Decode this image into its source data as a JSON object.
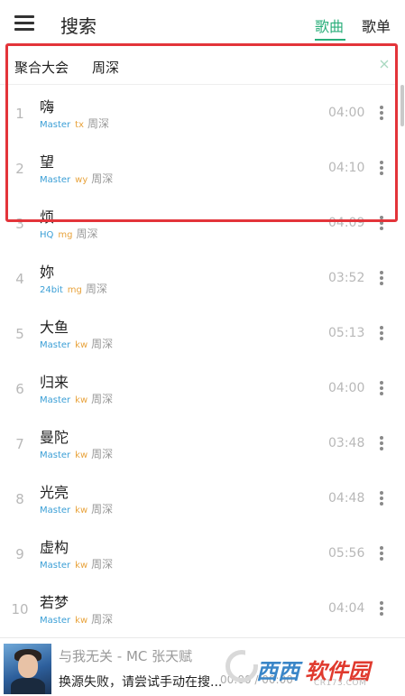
{
  "header": {
    "title": "搜索",
    "tab_songs": "歌曲",
    "tab_playlists": "歌单"
  },
  "query": {
    "source": "聚合大会",
    "term": "周深"
  },
  "songs": [
    {
      "index": "1",
      "title": "嗨",
      "quality": "Master",
      "source": "tx",
      "artist": "周深",
      "duration": "04:00"
    },
    {
      "index": "2",
      "title": "望",
      "quality": "Master",
      "source": "wy",
      "artist": "周深",
      "duration": "04:10"
    },
    {
      "index": "3",
      "title": "烦",
      "quality": "HQ",
      "source": "mg",
      "artist": "周深",
      "duration": "04:09"
    },
    {
      "index": "4",
      "title": "妳",
      "quality": "24bit",
      "source": "mg",
      "artist": "周深",
      "duration": "03:52"
    },
    {
      "index": "5",
      "title": "大鱼",
      "quality": "Master",
      "source": "kw",
      "artist": "周深",
      "duration": "05:13"
    },
    {
      "index": "6",
      "title": "归来",
      "quality": "Master",
      "source": "kw",
      "artist": "周深",
      "duration": "04:00"
    },
    {
      "index": "7",
      "title": "曼陀",
      "quality": "Master",
      "source": "kw",
      "artist": "周深",
      "duration": "03:48"
    },
    {
      "index": "8",
      "title": "光亮",
      "quality": "Master",
      "source": "kw",
      "artist": "周深",
      "duration": "04:48"
    },
    {
      "index": "9",
      "title": "虚构",
      "quality": "Master",
      "source": "kw",
      "artist": "周深",
      "duration": "05:56"
    },
    {
      "index": "10",
      "title": "若梦",
      "quality": "Master",
      "source": "kw",
      "artist": "周深",
      "duration": "04:04"
    }
  ],
  "player": {
    "title": "与我无关 - MC 张天赋",
    "status": "换源失败，请尝试手动在搜...",
    "time": "00:00 / 00:00"
  },
  "watermark": {
    "brand_a": "西西",
    "brand_b": "软件园",
    "site": "CR173.COM"
  },
  "colors": {
    "accent": "#2aae7a",
    "quality": "#3b9fd6",
    "source": "#e8a33c",
    "highlight": "#e3343a"
  },
  "icons": {
    "menu": "menu-icon",
    "clear": "close-icon",
    "more": "more-vertical-icon"
  }
}
